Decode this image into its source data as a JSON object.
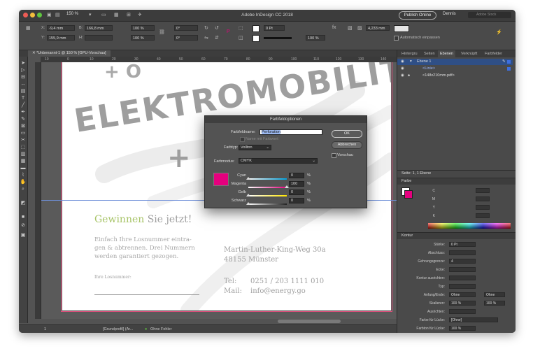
{
  "window": {
    "title": "Adobe InDesign CC 2018",
    "zoom": "150 %",
    "publish": "Publish Online",
    "user": "Dennis",
    "stock_placeholder": "Adobe Stock"
  },
  "control": {
    "x": "-9,4 mm",
    "y": "155,9 mm",
    "w": "166,8 mm",
    "h": "",
    "scale_x": "100 %",
    "scale_y": "100 %",
    "rot": "0°",
    "shear": "0°",
    "stroke": "0 Pt",
    "opacity": "100 %",
    "size": "4,233 mm",
    "autofit": "Automatisch einpassen"
  },
  "document_tab": "*Unbenannt-1 @ 150 % [GPU-Vorschau]",
  "ruler": [
    "10",
    "0",
    "10",
    "20",
    "30",
    "40",
    "50",
    "60",
    "70",
    "80",
    "90",
    "100",
    "110",
    "120",
    "130",
    "140",
    "150"
  ],
  "page": {
    "headline_green": "Gewinnen",
    "headline_rest": " Sie jetzt!",
    "los_text": [
      "Einfach Ihre Losnummer eintra-",
      "gen & abtrennen. Drei Nummern",
      "werden garantiert gezogen."
    ],
    "los_label": "Ihre Losnummer:",
    "address": [
      "Martin-Luther-King-Weg 30a",
      "48155 Münster"
    ],
    "tel_label": "Tel:",
    "tel_value": "0251 / 203 1111 010",
    "mail_label": "Mail:",
    "mail_value": "info@energy.go",
    "bg_word": "ELEKTROMOBILITÄT"
  },
  "status": {
    "page": "1",
    "profile": "[Grundprofil] (Ar...",
    "errors": "Ohne Fehler"
  },
  "panel": {
    "tabs": [
      "Hintergru",
      "Seiten",
      "Ebenen",
      "Verknüpft",
      "Farbfelder"
    ],
    "active_tab": "Ebenen",
    "layers": [
      "Ebene 1",
      "<Linie>",
      "<148x210mm.pdf>"
    ],
    "layer_footer": "Seite: 1, 1 Ebene",
    "farbe_title": "Farbe",
    "farbe_channels": [
      "C",
      "M",
      "Y",
      "K"
    ],
    "kontur_title": "Kontur",
    "kontur_rows": [
      {
        "label": "Stärke:",
        "value": "0 Pt"
      },
      {
        "label": "Abschluss:",
        "value": ""
      },
      {
        "label": "Gehrungsgrenze:",
        "value": "4"
      },
      {
        "label": "Ecke:",
        "value": ""
      },
      {
        "label": "Kontur ausrichten:",
        "value": ""
      },
      {
        "label": "Typ:",
        "value": ""
      },
      {
        "label": "Anfang/Ende:",
        "value": "Ohne"
      },
      {
        "label": "Skalieren:",
        "value": "100 %"
      },
      {
        "label": "Ausrichten:",
        "value": ""
      },
      {
        "label": "Farbe für Lücke:",
        "value": "[Ohne]"
      },
      {
        "label": "Farbton für Lücke:",
        "value": "100 %"
      }
    ],
    "anfang_ende_end": "Ohne",
    "skalieren_end": "100 %"
  },
  "dialog": {
    "title": "Farbfeldoptionen",
    "name_label": "Farbfeldname:",
    "name_value": "Perforation",
    "name_with_value": "Name mit Farbwert",
    "type_label": "Farbtyp:",
    "type_value": "Vollton",
    "mode_label": "Farbmodus:",
    "mode_value": "CMYK",
    "ok": "OK",
    "cancel": "Abbrechen",
    "preview": "Vorschau",
    "swatch_color": "#e5007e",
    "channels": [
      {
        "label": "Cyan",
        "value": "0",
        "fraction": 0.0
      },
      {
        "label": "Magenta",
        "value": "100",
        "fraction": 1.0
      },
      {
        "label": "Gelb",
        "value": "0",
        "fraction": 0.0
      },
      {
        "label": "Schwarz",
        "value": "0",
        "fraction": 0.0
      }
    ],
    "pct_unit": "%"
  },
  "colors": {
    "accent_green": "#a8c468",
    "magenta": "#e5007e",
    "selection": "#2f4f86"
  }
}
